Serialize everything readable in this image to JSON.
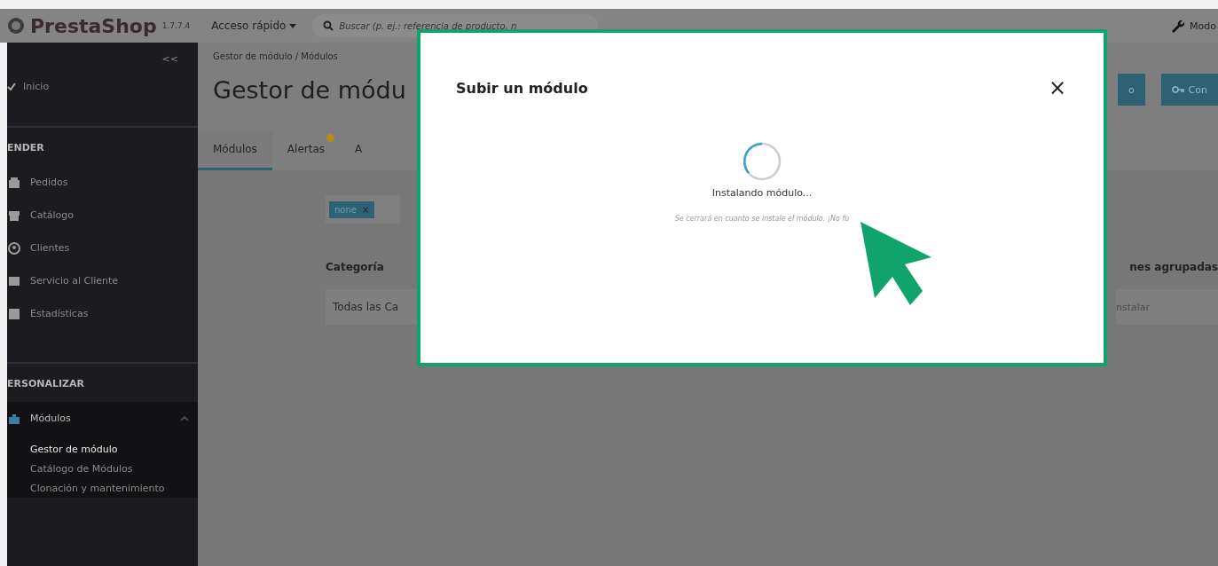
{
  "topbar": {
    "logo": "PrestaShop",
    "version": "1.7.7.4",
    "quick_access": "Acceso rápido",
    "search": {
      "placeholder": "Buscar (p. ej.: referencia de producto, n"
    },
    "mode": "Modo"
  },
  "sidebar": {
    "collapse": "<<",
    "home": "Inicio",
    "sections": [
      {
        "title": "ENDER",
        "items": [
          {
            "label": "Pedidos",
            "expanded": false
          },
          {
            "label": "Catálogo",
            "expanded": false
          },
          {
            "label": "Clientes",
            "expanded": false
          },
          {
            "label": "Servicio al Cliente",
            "expanded": false
          },
          {
            "label": "Estadísticas",
            "expanded": false
          }
        ]
      },
      {
        "title": "ERSONALIZAR",
        "items": [
          {
            "label": "Módulos",
            "expanded": true,
            "children": [
              {
                "label": "Gestor de módulo",
                "selected": true
              },
              {
                "label": "Catálogo de Módulos",
                "selected": false
              },
              {
                "label": "Clonación y mantenimiento",
                "selected": false
              }
            ]
          }
        ]
      }
    ]
  },
  "header": {
    "breadcrumb": "Gestor de módulo / Módulos",
    "title": "Gestor de módu",
    "buttons": [
      {
        "label": "o",
        "kind": "plain"
      },
      {
        "label": "Con",
        "kind": "key"
      }
    ],
    "tabs": [
      {
        "label": "Módulos",
        "selected": true,
        "badge": false
      },
      {
        "label": "Alertas",
        "selected": false,
        "badge": true
      },
      {
        "label": "A",
        "selected": false,
        "badge": false
      }
    ]
  },
  "filters": {
    "tag": "none",
    "tag_remove": "×",
    "category_label": "Categoría",
    "category_value": "Todas las Ca",
    "bulk_label": "nes agrupadas",
    "bulk_value": "nstalar"
  },
  "modal": {
    "title": "Subir un módulo",
    "close": "×",
    "status": "Instalando módulo...",
    "note": "Se cerrará en cuanto se instale el módulo. ¡No fu"
  }
}
